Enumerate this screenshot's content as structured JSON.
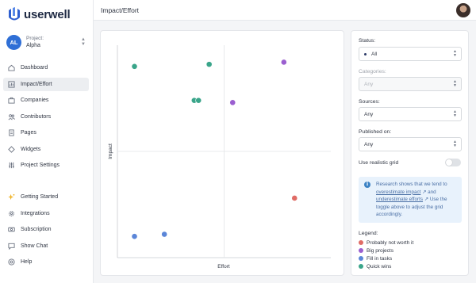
{
  "app": {
    "logo_text": "userwell"
  },
  "project": {
    "label": "Project:",
    "name": "Alpha",
    "initials": "AL"
  },
  "nav": [
    {
      "label": "Dashboard",
      "icon": "home-icon",
      "name": "dashboard"
    },
    {
      "label": "Impact/Effort",
      "icon": "chart-icon",
      "name": "impact-effort",
      "active": true
    },
    {
      "label": "Companies",
      "icon": "briefcase-icon",
      "name": "companies"
    },
    {
      "label": "Contributors",
      "icon": "users-icon",
      "name": "contributors"
    },
    {
      "label": "Pages",
      "icon": "pages-icon",
      "name": "pages"
    },
    {
      "label": "Widgets",
      "icon": "widget-icon",
      "name": "widgets"
    },
    {
      "label": "Project Settings",
      "icon": "sliders-icon",
      "name": "project-settings"
    }
  ],
  "nav_bottom": [
    {
      "label": "Getting Started",
      "icon": "sparkle-icon",
      "name": "getting-started"
    },
    {
      "label": "Integrations",
      "icon": "gear-icon",
      "name": "integrations"
    },
    {
      "label": "Subscription",
      "icon": "money-icon",
      "name": "subscription"
    },
    {
      "label": "Show Chat",
      "icon": "chat-icon",
      "name": "show-chat"
    },
    {
      "label": "Help",
      "icon": "help-icon",
      "name": "help"
    }
  ],
  "header": {
    "title": "Impact/Effort"
  },
  "filters": {
    "status_label": "Status:",
    "status_value": "All",
    "categories_label": "Categories:",
    "categories_value": "Any",
    "sources_label": "Sources:",
    "sources_value": "Any",
    "published_label": "Published on:",
    "published_value": "Any",
    "realistic_grid_label": "Use realistic grid",
    "realistic_grid_on": false
  },
  "info": {
    "text_1": "Research shows that we tend to",
    "link_1": "overestimate impact",
    "text_2": "and",
    "link_2": "underestimate efforts",
    "text_3": "Use the toggle above to adjust the grid accordingly."
  },
  "legend": {
    "title": "Legend:",
    "items": [
      {
        "label": "Probably not worth it",
        "color": "#e06c66"
      },
      {
        "label": "Big projects",
        "color": "#9b5fd0"
      },
      {
        "label": "Fill in tasks",
        "color": "#5b86d8"
      },
      {
        "label": "Quick wins",
        "color": "#3aa58a"
      }
    ]
  },
  "chart_data": {
    "type": "scatter",
    "xlabel": "Effort",
    "ylabel": "Impact",
    "xlim": [
      0,
      100
    ],
    "ylim": [
      0,
      100
    ],
    "quadrant_split": {
      "x": 50,
      "y": 50
    },
    "series": [
      {
        "name": "Quick wins",
        "color": "#3aa58a",
        "points": [
          [
            8,
            90
          ],
          [
            43,
            91
          ],
          [
            36,
            74
          ],
          [
            38,
            74
          ]
        ]
      },
      {
        "name": "Big projects",
        "color": "#9b5fd0",
        "points": [
          [
            78,
            92
          ],
          [
            54,
            73
          ]
        ]
      },
      {
        "name": "Probably not worth it",
        "color": "#e06c66",
        "points": [
          [
            83,
            28
          ]
        ]
      },
      {
        "name": "Fill in tasks",
        "color": "#5b86d8",
        "points": [
          [
            8,
            10
          ],
          [
            22,
            11
          ]
        ]
      }
    ]
  }
}
